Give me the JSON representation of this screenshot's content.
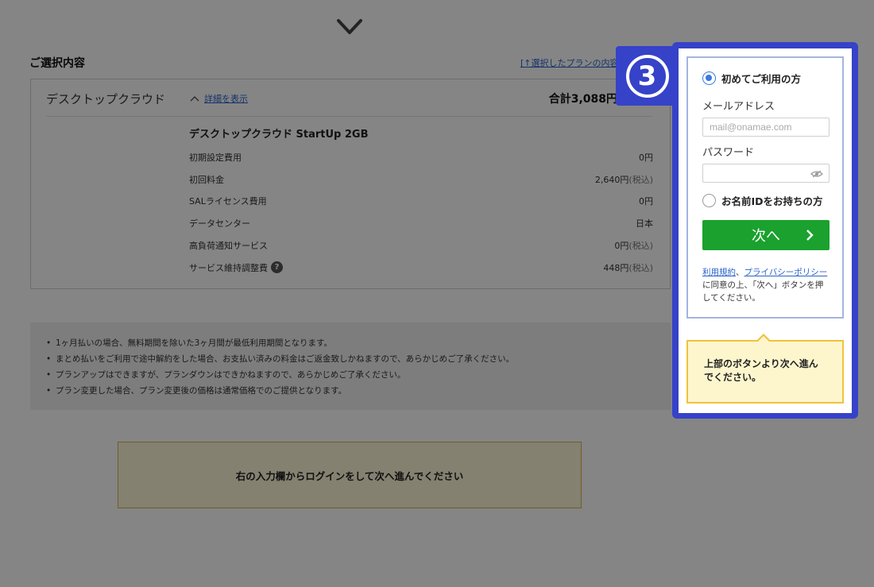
{
  "summary": {
    "title": "ご選択内容",
    "anchor_link": "[↑選択したプランの内容を変更する]",
    "product_name": "デスクトップクラウド",
    "detail_toggle": "詳細を表示",
    "total": "合計3,088円",
    "plan_name": "デスクトップクラウド StartUp 2GB",
    "fees": [
      {
        "label": "初期設定費用",
        "value": "0円",
        "tax": ""
      },
      {
        "label": "初回料金",
        "value": "2,640円",
        "tax": "(税込)"
      },
      {
        "label": "SALライセンス費用",
        "value": "0円",
        "tax": ""
      },
      {
        "label": "データセンター",
        "value": "日本",
        "tax": ""
      },
      {
        "label": "高負荷通知サービス",
        "value": "0円",
        "tax": "(税込)"
      },
      {
        "label": "サービス維持調整費",
        "value": "448円",
        "tax": "(税込)"
      }
    ]
  },
  "notes": [
    "1ヶ月払いの場合、無料期間を除いた3ヶ月間が最低利用期間となります。",
    "まとめ払いをご利用で途中解約をした場合、お支払い済みの料金はご返金致しかねますので、あらかじめご了承ください。",
    "プランアップはできますが、プランダウンはできかねますので、あらかじめご了承ください。",
    "プラン変更した場合、プラン変更後の価格は通常価格でのご提供となります。"
  ],
  "login_prompt": "右の入力欄からログインをして次へ進んでください",
  "step": {
    "number": "3"
  },
  "login": {
    "option_new": "初めてご利用の方",
    "email_label": "メールアドレス",
    "email_placeholder": "mail@onamae.com",
    "password_label": "パスワード",
    "option_existing": "お名前IDをお持ちの方",
    "next_button": "次へ",
    "consent_terms": "利用規約",
    "consent_sep": "、",
    "consent_privacy": "プライバシーポリシー",
    "consent_text": "に同意の上、「次へ」ボタンを押してください。"
  },
  "tooltip": "上部のボタンより次へ進んでください。",
  "colors": {
    "accent_blue": "#3642c8",
    "button_green": "#1aa12e",
    "tooltip_border": "#f0c23b",
    "link": "#2a62c9"
  }
}
